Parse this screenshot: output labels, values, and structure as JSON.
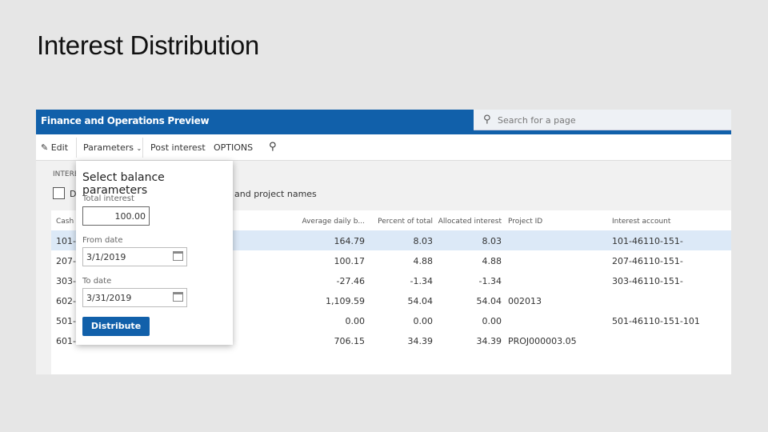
{
  "slide_title": "Interest Distribution",
  "app": {
    "title": "Finance and Operations Preview",
    "search_placeholder": "Search for a page"
  },
  "toolbar": {
    "edit": "Edit",
    "parameters": "Parameters",
    "post_interest": "Post interest",
    "options": "OPTIONS"
  },
  "section": {
    "label": "INTERE",
    "checkbox_label_start": "D",
    "checkbox_label_end": "and project names"
  },
  "grid": {
    "headers": [
      "Cash a",
      "Average daily b...",
      "Percent of total",
      "Allocated interest",
      "Project ID",
      "Interest account"
    ],
    "rows": [
      {
        "cash": "101-1",
        "avg": "164.79",
        "pct": "8.03",
        "alloc": "8.03",
        "project": "",
        "account": "101-46110-151-"
      },
      {
        "cash": "207-1",
        "avg": "100.17",
        "pct": "4.88",
        "alloc": "4.88",
        "project": "",
        "account": "207-46110-151-"
      },
      {
        "cash": "303-1",
        "avg": "-27.46",
        "pct": "-1.34",
        "alloc": "-1.34",
        "project": "",
        "account": "303-46110-151-"
      },
      {
        "cash": "602-1",
        "avg": "1,109.59",
        "pct": "54.04",
        "alloc": "54.04",
        "project": "002013",
        "account": ""
      },
      {
        "cash": "501-1",
        "avg": "0.00",
        "pct": "0.00",
        "alloc": "0.00",
        "project": "",
        "account": "501-46110-151-101"
      },
      {
        "cash": "601-",
        "avg": "706.15",
        "pct": "34.39",
        "alloc": "34.39",
        "project": "PROJ000003.05",
        "account": ""
      }
    ]
  },
  "popup": {
    "title": "Select balance parameters",
    "total_interest_label": "Total interest",
    "total_interest": "100.00",
    "from_label": "From date",
    "from": "3/1/2019",
    "to_label": "To date",
    "to": "3/31/2019",
    "distribute": "Distribute"
  },
  "colors": {
    "brand": "#1160aa",
    "selected_row": "#dce9f7"
  }
}
